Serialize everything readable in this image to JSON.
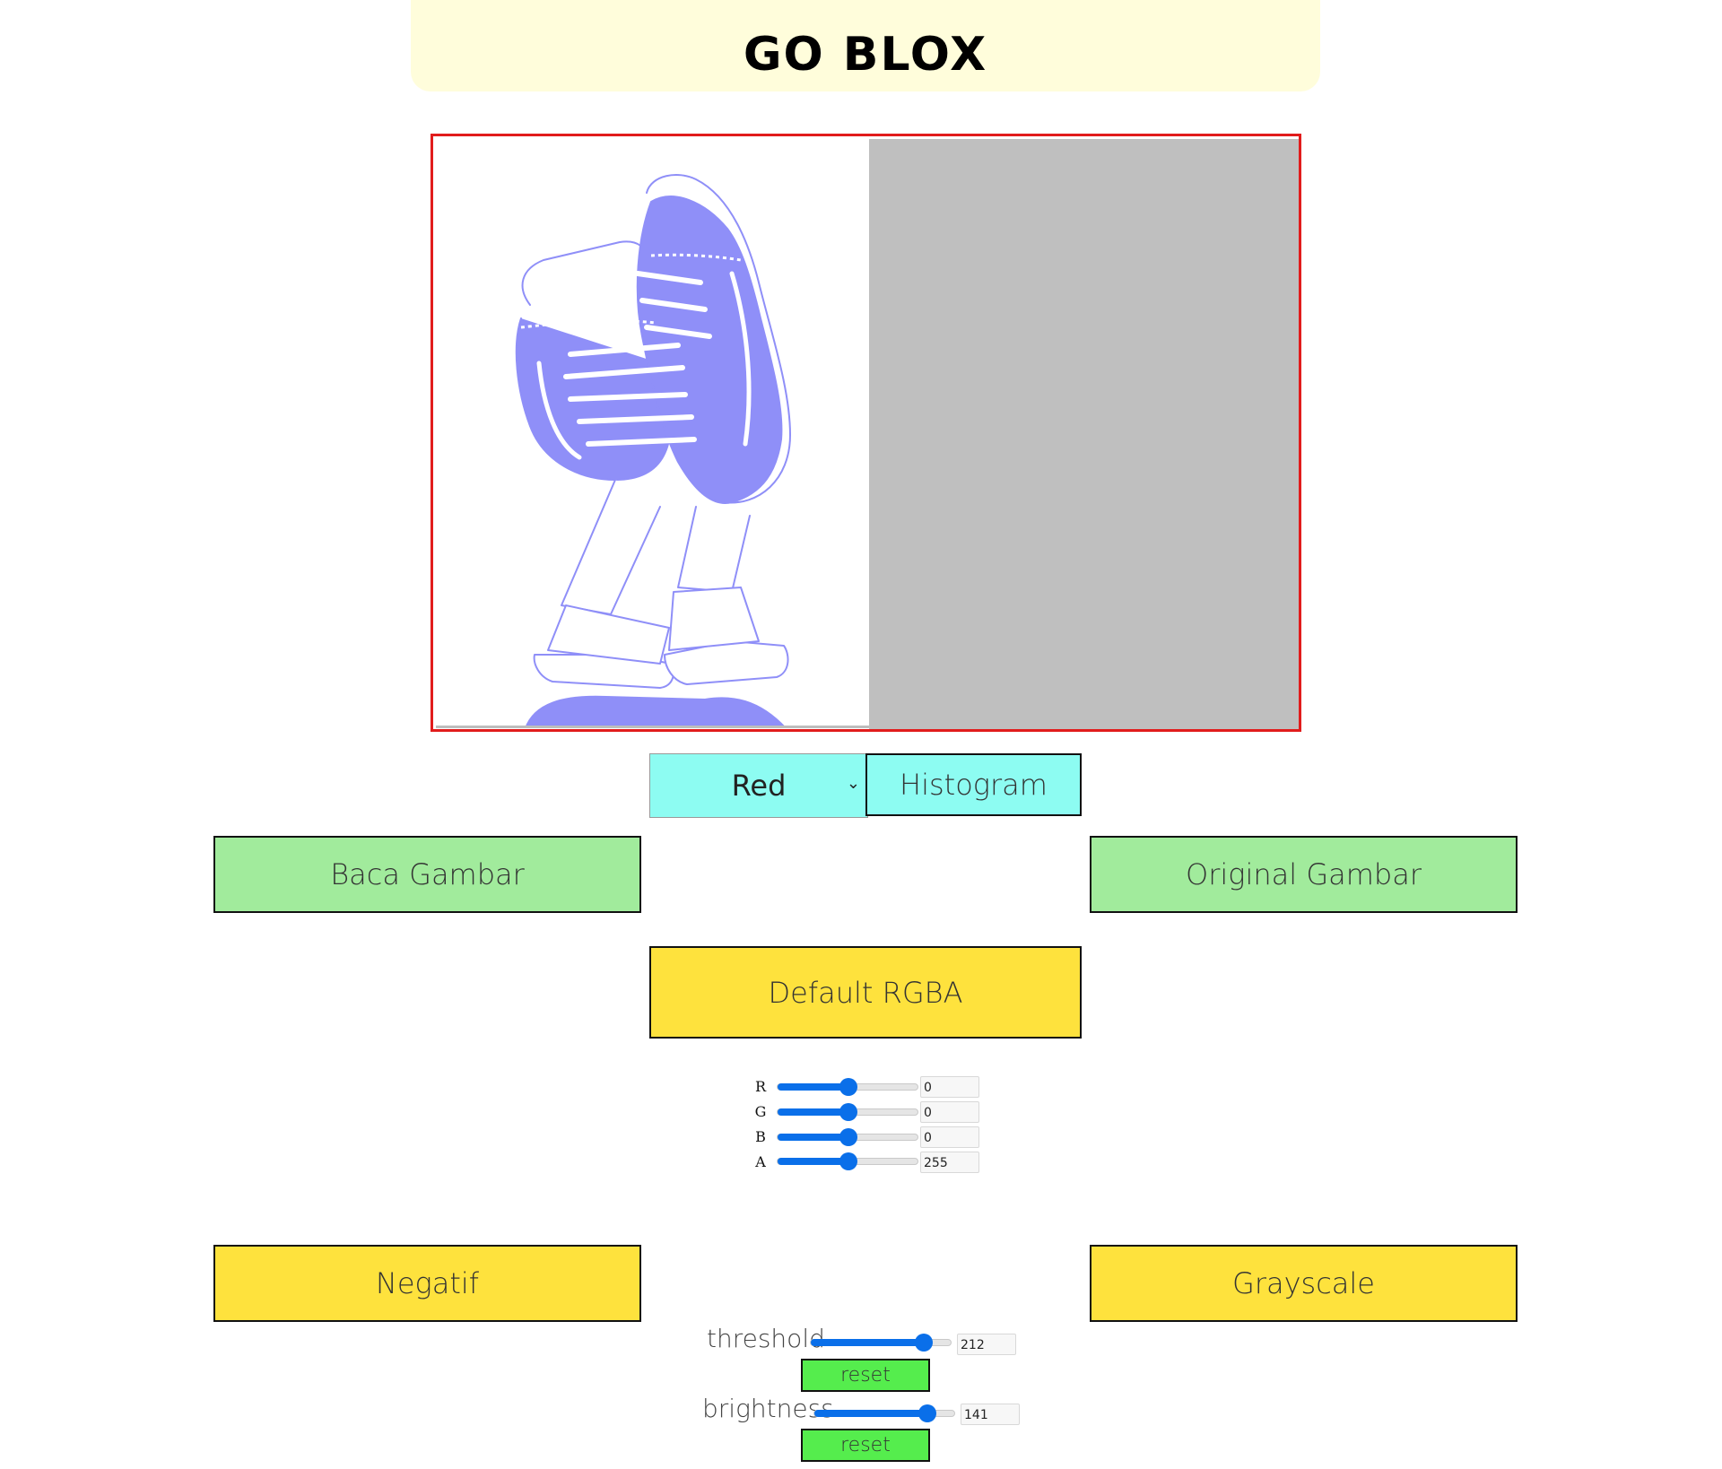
{
  "header": {
    "title": "GO BLOX"
  },
  "controls": {
    "channel_select": {
      "selected": "Red"
    },
    "histogram_label": "Histogram",
    "baca_label": "Baca Gambar",
    "original_label": "Original Gambar",
    "default_label": "Default RGBA",
    "negatif_label": "Negatif",
    "grayscale_label": "Grayscale"
  },
  "rgba": {
    "r": {
      "label": "R",
      "value": "0",
      "level": 0.5
    },
    "g": {
      "label": "G",
      "value": "0",
      "level": 0.5
    },
    "b": {
      "label": "B",
      "value": "0",
      "level": 0.5
    },
    "a": {
      "label": "A",
      "value": "255",
      "level": 0.5
    }
  },
  "threshold": {
    "label": "threshold",
    "value": "212",
    "level": 0.8,
    "reset_label": "reset"
  },
  "brightness": {
    "label": "brightness",
    "value": "141",
    "level": 0.8,
    "reset_label": "reset"
  },
  "colors": {
    "accent_blue": "#0a6fe9",
    "shoe_tint": "#8f8ff8",
    "canvas_border": "#e11c1c",
    "cyan": "#8dfcf2",
    "green": "#a1eb9c",
    "yellow": "#fee23d",
    "reset_green": "#55ed4d"
  },
  "image": {
    "subject": "sneakers illustration",
    "icon": "shoes-illustration"
  }
}
